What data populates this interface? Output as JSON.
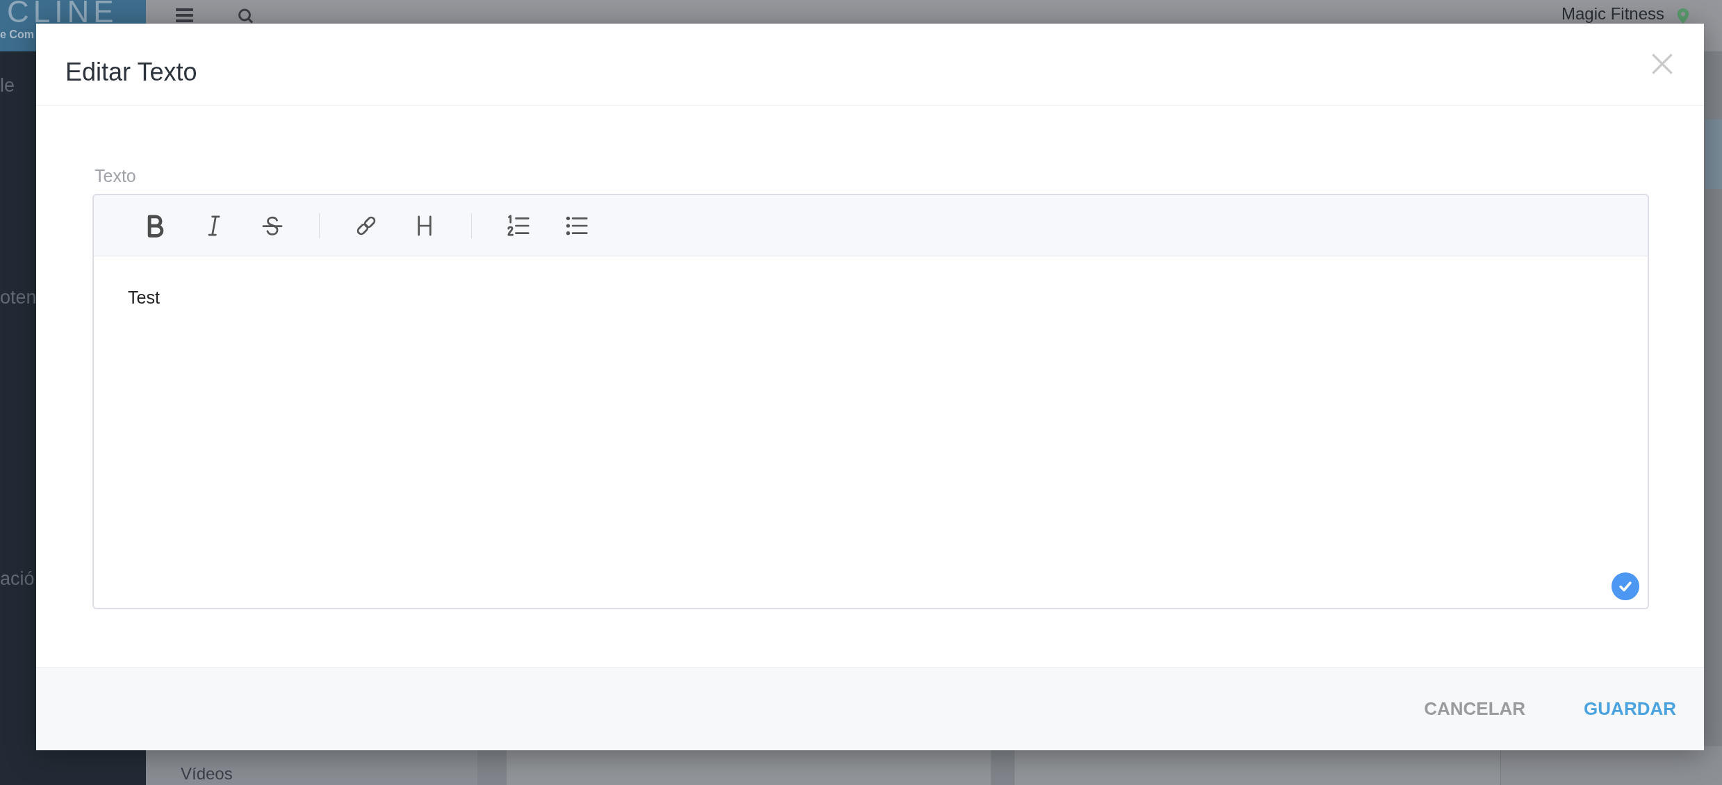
{
  "app_background": {
    "logo": {
      "name": "CLINE",
      "tagline": "e Com"
    },
    "sidebar_items": [
      "le",
      "oten",
      "ació"
    ],
    "top_bar": {
      "location": "Magic Fitness"
    },
    "content": {
      "section_title": "Vídeos"
    }
  },
  "dialog": {
    "title": "Editar Texto",
    "field": {
      "label": "Texto",
      "toolbar": [
        {
          "kind": "bold"
        },
        {
          "kind": "italic"
        },
        {
          "kind": "strike"
        },
        {
          "kind": "separator"
        },
        {
          "kind": "link"
        },
        {
          "kind": "heading"
        },
        {
          "kind": "separator"
        },
        {
          "kind": "ordered-list"
        },
        {
          "kind": "bullet-list"
        }
      ],
      "value": "Test"
    },
    "buttons": [
      {
        "label": "CANCELAR",
        "kind": "secondary"
      },
      {
        "label": "GUARDAR",
        "kind": "primary"
      }
    ]
  }
}
